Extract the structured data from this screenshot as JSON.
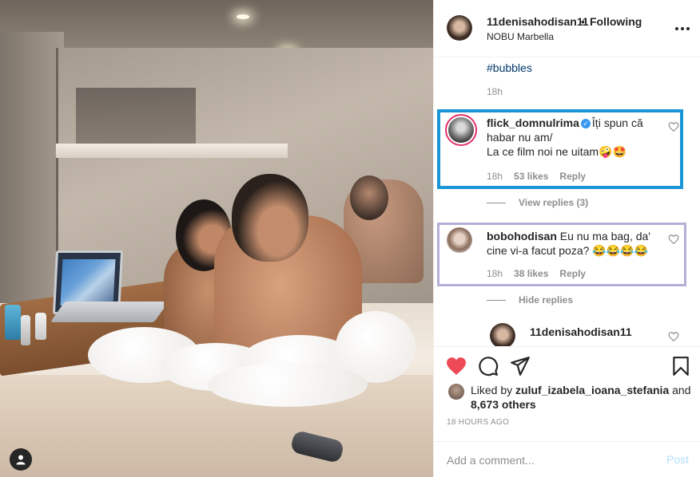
{
  "post": {
    "author": "11denisahodisan11",
    "separator": "•",
    "follow_state": "Following",
    "location": "NOBU Marbella",
    "more_icon": "more-options-icon"
  },
  "caption": {
    "hashtag": "#bubbles",
    "time": "18h"
  },
  "comments": [
    {
      "username": "flick_domnulrima",
      "verified": true,
      "text_line1": "Îți spun că",
      "text_line2": "habar nu am/",
      "text_line3": "La ce film noi ne uitam🤪🤩",
      "time": "18h",
      "likes": "53 likes",
      "reply": "Reply",
      "replies_toggle": "View replies (3)"
    },
    {
      "username": "bobohodisan",
      "text_line1": "Eu nu ma bag, da'",
      "text_line2": "cine vi-a facut poza? 😂😂😂😂",
      "time": "18h",
      "likes": "38 likes",
      "reply": "Reply",
      "replies_toggle": "Hide replies"
    },
    {
      "username": "11denisahodisan11"
    }
  ],
  "actions": {
    "like_icon": "heart-filled-icon",
    "comment_icon": "comment-icon",
    "share_icon": "share-icon",
    "save_icon": "bookmark-icon",
    "like_color": "#ed4956"
  },
  "likes": {
    "prefix": "Liked by",
    "user": "zuluf_izabela_ioana_stefania",
    "and": "and",
    "count": "8,673 others"
  },
  "timestamp": "18 HOURS AGO",
  "add_comment": {
    "placeholder": "Add a comment...",
    "post_label": "Post"
  },
  "highlight_colors": {
    "blue": "#1a96d6",
    "purple": "#b5afd6"
  }
}
